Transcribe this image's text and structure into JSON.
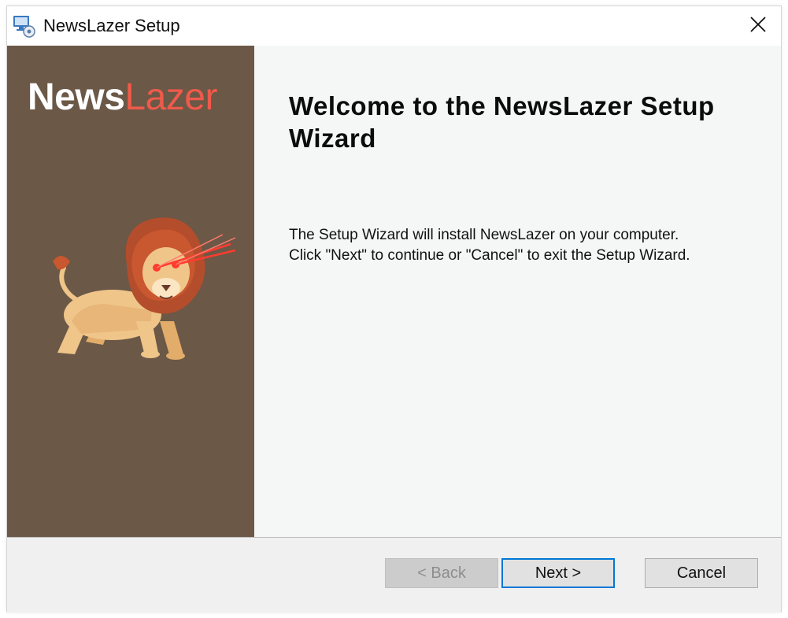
{
  "window": {
    "title": "NewsLazer Setup"
  },
  "sidebar": {
    "logo_part1": "News",
    "logo_part2": "Lazer",
    "illustration": "lion-with-laser-eyes"
  },
  "main": {
    "heading": "Welcome to the NewsLazer Setup Wizard",
    "line1": "The Setup Wizard will install NewsLazer on your computer.",
    "line2": "Click \"Next\" to continue or \"Cancel\" to exit the Setup Wizard."
  },
  "footer": {
    "back_label": "< Back",
    "back_enabled": false,
    "next_label": "Next >",
    "cancel_label": "Cancel"
  },
  "colors": {
    "sidebar_bg": "#6b5847",
    "logo_accent": "#ef5a4a",
    "focus_border": "#0078d7"
  },
  "icons": {
    "app": "setup-computer-icon",
    "close": "close-icon"
  }
}
